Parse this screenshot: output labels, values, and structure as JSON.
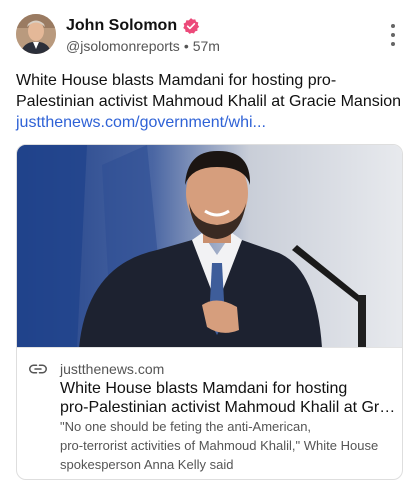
{
  "post": {
    "author": {
      "display_name": "John Solomon",
      "handle": "@jsolomonreports",
      "separator": "•",
      "time_ago": "57m",
      "verified_icon": "verified-badge-icon"
    },
    "text": "White House blasts Mamdani for hosting pro-Palestinian activist Mahmoud Khalil at Gracie Mansion",
    "link_text": "justthenews.com/government/whi...",
    "menu_icon": "more-vertical-icon"
  },
  "card": {
    "image_icon": "article-photo",
    "link_icon": "link-icon",
    "domain": "justthenews.com",
    "title_lines": [
      "White House blasts Mamdani for hosting",
      "pro-Palestinian activist Mahmoud Khalil at Gra..."
    ],
    "description_lines": [
      "\"No one should be feting the anti-American,",
      "pro-terrorist activities of Mahmoud Khalil,\" White House",
      "spokesperson Anna Kelly said"
    ]
  },
  "colors": {
    "link": "#2f62d6",
    "verified_badge": "#ec4a7a",
    "secondary_text": "#555555",
    "card_border": "#dedede"
  }
}
